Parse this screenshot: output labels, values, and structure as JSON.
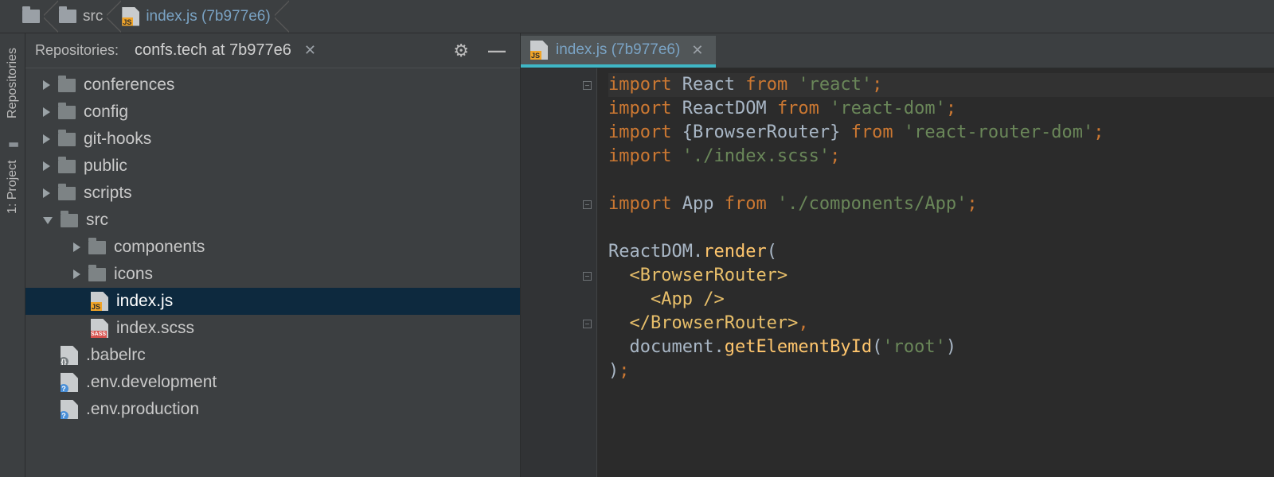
{
  "breadcrumb": {
    "root": "",
    "folder": "src",
    "file": "index.js (7b977e6)"
  },
  "vtabs": {
    "repositories": "Repositories",
    "project": "1: Project"
  },
  "panel": {
    "label": "Repositories:",
    "repo": "confs.tech at 7b977e6"
  },
  "tree": [
    {
      "name": "conferences",
      "depth": 0,
      "kind": "folder",
      "arrow": "right"
    },
    {
      "name": "config",
      "depth": 0,
      "kind": "folder",
      "arrow": "right"
    },
    {
      "name": "git-hooks",
      "depth": 0,
      "kind": "folder",
      "arrow": "right"
    },
    {
      "name": "public",
      "depth": 0,
      "kind": "folder",
      "arrow": "right"
    },
    {
      "name": "scripts",
      "depth": 0,
      "kind": "folder",
      "arrow": "right"
    },
    {
      "name": "src",
      "depth": 0,
      "kind": "folder",
      "arrow": "down"
    },
    {
      "name": "components",
      "depth": 1,
      "kind": "folder",
      "arrow": "right"
    },
    {
      "name": "icons",
      "depth": 1,
      "kind": "folder",
      "arrow": "right"
    },
    {
      "name": "index.js",
      "depth": 1,
      "kind": "jsfile",
      "arrow": "none",
      "selected": true
    },
    {
      "name": "index.scss",
      "depth": 1,
      "kind": "sassfile",
      "arrow": "none"
    },
    {
      "name": ".babelrc",
      "depth": 0,
      "kind": "bracefile",
      "arrow": "none"
    },
    {
      "name": ".env.development",
      "depth": 0,
      "kind": "qfile",
      "arrow": "none"
    },
    {
      "name": ".env.production",
      "depth": 0,
      "kind": "qfile",
      "arrow": "none"
    }
  ],
  "editor": {
    "tab": "index.js (7b977e6)",
    "gutter": [
      "fold",
      "",
      "",
      "",
      "",
      "fold",
      "",
      "",
      "fold",
      "",
      "fold",
      "",
      ""
    ],
    "code": [
      {
        "hl": true,
        "tokens": [
          [
            "kw",
            "import "
          ],
          [
            "plain",
            "React "
          ],
          [
            "kw",
            "from "
          ],
          [
            "str",
            "'react'"
          ],
          [
            "punc",
            ";"
          ]
        ]
      },
      {
        "tokens": [
          [
            "kw",
            "import "
          ],
          [
            "plain",
            "ReactDOM "
          ],
          [
            "kw",
            "from "
          ],
          [
            "str",
            "'react-dom'"
          ],
          [
            "punc",
            ";"
          ]
        ]
      },
      {
        "tokens": [
          [
            "kw",
            "import "
          ],
          [
            "plain",
            "{BrowserRouter} "
          ],
          [
            "kw",
            "from "
          ],
          [
            "str",
            "'react-router-dom'"
          ],
          [
            "punc",
            ";"
          ]
        ]
      },
      {
        "tokens": [
          [
            "kw",
            "import "
          ],
          [
            "str",
            "'./index.scss'"
          ],
          [
            "punc",
            ";"
          ]
        ]
      },
      {
        "tokens": []
      },
      {
        "tokens": [
          [
            "kw",
            "import "
          ],
          [
            "plain",
            "App "
          ],
          [
            "kw",
            "from "
          ],
          [
            "str",
            "'./components/App'"
          ],
          [
            "punc",
            ";"
          ]
        ]
      },
      {
        "tokens": []
      },
      {
        "tokens": [
          [
            "plain",
            "ReactDOM."
          ],
          [
            "fn",
            "render"
          ],
          [
            "plain",
            "("
          ]
        ]
      },
      {
        "tokens": [
          [
            "plain",
            "  "
          ],
          [
            "jsx",
            "<BrowserRouter>"
          ]
        ]
      },
      {
        "tokens": [
          [
            "plain",
            "    "
          ],
          [
            "jsx",
            "<App />"
          ]
        ]
      },
      {
        "tokens": [
          [
            "plain",
            "  "
          ],
          [
            "jsx",
            "</BrowserRouter>"
          ],
          [
            "punc",
            ","
          ]
        ]
      },
      {
        "tokens": [
          [
            "plain",
            "  document."
          ],
          [
            "fn",
            "getElementById"
          ],
          [
            "plain",
            "("
          ],
          [
            "str",
            "'root'"
          ],
          [
            "plain",
            ")"
          ]
        ]
      },
      {
        "tokens": [
          [
            "plain",
            ")"
          ],
          [
            "punc",
            ";"
          ]
        ]
      }
    ]
  }
}
